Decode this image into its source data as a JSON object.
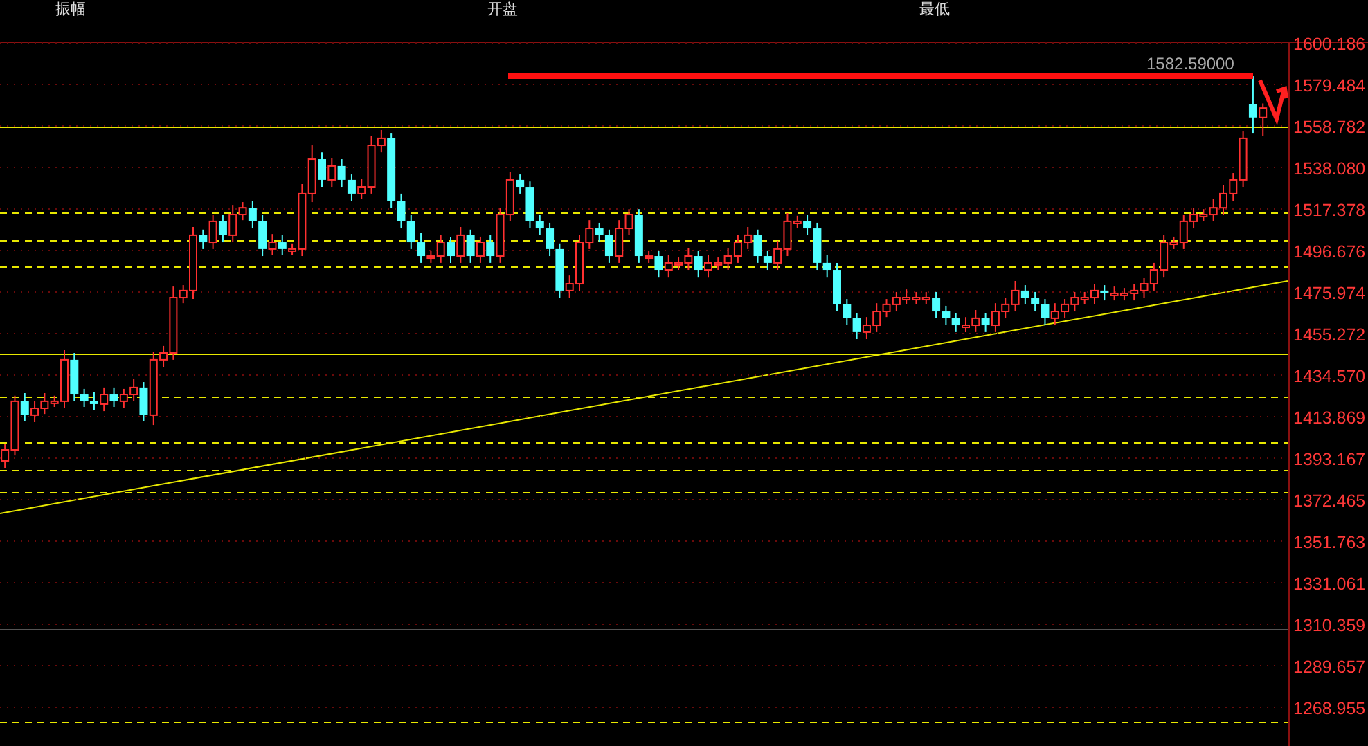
{
  "header": {
    "items": [
      {
        "label": "振幅"
      },
      {
        "label": "开盘"
      },
      {
        "label": "最低"
      }
    ]
  },
  "chart": {
    "price_marker": "1582.59000",
    "chart_data": {
      "type": "candlestick",
      "ylim": [
        1249.64,
        1600.87
      ],
      "grid": true,
      "categories": [
        null,
        null,
        null,
        null,
        null,
        null,
        null,
        null,
        null,
        null,
        null,
        null,
        null,
        null,
        null,
        null,
        null,
        null,
        null,
        null,
        null,
        null,
        null,
        null,
        null,
        null,
        null,
        null,
        null,
        null,
        null,
        null,
        null,
        null,
        null,
        null,
        null,
        null,
        null,
        null,
        null,
        null,
        null,
        null,
        null,
        null,
        null,
        null,
        null,
        null,
        null,
        null,
        null,
        null,
        null,
        null,
        null,
        null,
        null,
        null,
        null,
        null,
        null,
        null,
        null,
        null,
        null,
        null,
        null,
        null,
        null,
        null,
        null,
        null,
        null,
        null,
        null,
        null,
        null,
        null,
        null,
        null,
        null,
        null,
        null,
        null,
        null,
        null,
        null,
        null,
        null,
        null,
        null,
        null,
        null,
        null,
        null,
        null,
        null,
        null,
        null,
        null,
        null,
        null,
        null,
        null,
        null,
        null,
        null,
        null,
        null,
        null,
        null,
        null,
        null,
        null,
        null,
        null,
        null,
        null,
        null,
        null,
        null,
        null,
        null,
        null,
        null,
        null,
        null,
        null
      ],
      "yticks": [
        {
          "value": 1600.186,
          "label": "1600.186"
        },
        {
          "value": 1579.484,
          "label": "1579.484"
        },
        {
          "value": 1558.782,
          "label": "1558.782"
        },
        {
          "value": 1538.08,
          "label": "1538.080"
        },
        {
          "value": 1517.378,
          "label": "1517.378"
        },
        {
          "value": 1496.676,
          "label": "1496.676"
        },
        {
          "value": 1475.974,
          "label": "1475.974"
        },
        {
          "value": 1455.272,
          "label": "1455.272"
        },
        {
          "value": 1434.57,
          "label": "1434.570"
        },
        {
          "value": 1413.869,
          "label": "1413.869"
        },
        {
          "value": 1393.167,
          "label": "1393.167"
        },
        {
          "value": 1372.465,
          "label": "1372.465"
        },
        {
          "value": 1351.763,
          "label": "1351.763"
        },
        {
          "value": 1331.061,
          "label": "1331.061"
        },
        {
          "value": 1310.359,
          "label": "1310.359"
        },
        {
          "value": 1289.657,
          "label": "1289.657"
        },
        {
          "value": 1268.955,
          "label": "1268.955"
        }
      ],
      "ohlc": [
        [
          1391.8,
          1400.1,
          1388.0,
          1397.3
        ],
        [
          1397.3,
          1424.3,
          1394.5,
          1421.5
        ],
        [
          1421.5,
          1425.6,
          1411.8,
          1414.6
        ],
        [
          1414.6,
          1421.5,
          1411.1,
          1418.0
        ],
        [
          1418.0,
          1425.6,
          1415.2,
          1421.5
        ],
        [
          1421.5,
          1424.3,
          1418.7,
          1421.5
        ],
        [
          1421.5,
          1447.0,
          1418.0,
          1442.2
        ],
        [
          1442.2,
          1445.6,
          1421.5,
          1424.9
        ],
        [
          1424.9,
          1427.7,
          1418.7,
          1421.5
        ],
        [
          1421.5,
          1426.3,
          1417.3,
          1420.1
        ],
        [
          1420.1,
          1428.4,
          1416.6,
          1424.9
        ],
        [
          1424.9,
          1428.4,
          1418.7,
          1421.5
        ],
        [
          1421.5,
          1427.7,
          1418.0,
          1424.9
        ],
        [
          1424.9,
          1432.5,
          1421.5,
          1428.4
        ],
        [
          1428.4,
          1431.1,
          1411.8,
          1414.6
        ],
        [
          1414.6,
          1446.3,
          1409.7,
          1442.2
        ],
        [
          1442.2,
          1449.1,
          1438.7,
          1445.6
        ],
        [
          1445.6,
          1478.7,
          1442.2,
          1473.2
        ],
        [
          1473.2,
          1479.4,
          1470.4,
          1476.7
        ],
        [
          1476.7,
          1508.4,
          1472.5,
          1504.3
        ],
        [
          1504.3,
          1507.1,
          1497.4,
          1500.8
        ],
        [
          1500.8,
          1514.6,
          1497.4,
          1511.2
        ],
        [
          1511.2,
          1514.6,
          1500.8,
          1504.3
        ],
        [
          1504.3,
          1519.4,
          1500.8,
          1514.6
        ],
        [
          1514.6,
          1520.8,
          1511.8,
          1518.0
        ],
        [
          1518.0,
          1521.5,
          1507.7,
          1511.2
        ],
        [
          1511.2,
          1514.6,
          1493.9,
          1497.4
        ],
        [
          1497.4,
          1504.9,
          1494.6,
          1500.8
        ],
        [
          1500.8,
          1504.3,
          1494.6,
          1497.4
        ],
        [
          1497.4,
          1500.2,
          1494.6,
          1497.4
        ],
        [
          1497.4,
          1529.8,
          1493.9,
          1525.0
        ],
        [
          1525.0,
          1549.1,
          1520.8,
          1542.2
        ],
        [
          1542.2,
          1545.6,
          1528.4,
          1531.9
        ],
        [
          1531.9,
          1542.9,
          1528.4,
          1538.8
        ],
        [
          1538.8,
          1542.2,
          1528.4,
          1531.9
        ],
        [
          1531.9,
          1534.6,
          1521.5,
          1525.0
        ],
        [
          1525.0,
          1532.5,
          1522.2,
          1528.4
        ],
        [
          1528.4,
          1553.9,
          1525.0,
          1549.1
        ],
        [
          1549.1,
          1556.7,
          1545.6,
          1552.6
        ],
        [
          1552.6,
          1555.3,
          1518.0,
          1521.5
        ],
        [
          1521.5,
          1525.0,
          1507.7,
          1511.2
        ],
        [
          1511.2,
          1514.6,
          1497.4,
          1500.8
        ],
        [
          1500.8,
          1505.6,
          1490.5,
          1493.9
        ],
        [
          1493.9,
          1496.7,
          1490.5,
          1493.9
        ],
        [
          1493.9,
          1504.3,
          1490.5,
          1500.8
        ],
        [
          1500.8,
          1503.6,
          1490.5,
          1493.9
        ],
        [
          1493.9,
          1508.4,
          1490.5,
          1504.3
        ],
        [
          1504.3,
          1507.1,
          1490.5,
          1493.9
        ],
        [
          1493.9,
          1503.6,
          1490.5,
          1500.8
        ],
        [
          1500.8,
          1504.3,
          1490.5,
          1493.9
        ],
        [
          1493.9,
          1518.0,
          1490.5,
          1514.6
        ],
        [
          1514.6,
          1536.0,
          1511.2,
          1531.9
        ],
        [
          1531.9,
          1534.6,
          1525.0,
          1528.4
        ],
        [
          1528.4,
          1531.1,
          1507.7,
          1511.2
        ],
        [
          1511.2,
          1514.6,
          1504.3,
          1507.7
        ],
        [
          1507.7,
          1510.5,
          1493.9,
          1497.4
        ],
        [
          1497.4,
          1500.2,
          1473.2,
          1476.7
        ],
        [
          1476.7,
          1484.2,
          1473.2,
          1480.1
        ],
        [
          1480.1,
          1504.3,
          1476.7,
          1500.8
        ],
        [
          1500.8,
          1511.8,
          1497.4,
          1507.7
        ],
        [
          1507.7,
          1510.5,
          1500.8,
          1504.3
        ],
        [
          1504.3,
          1507.1,
          1490.5,
          1493.9
        ],
        [
          1493.9,
          1511.8,
          1490.5,
          1507.7
        ],
        [
          1507.7,
          1517.3,
          1504.3,
          1514.6
        ],
        [
          1514.6,
          1517.3,
          1490.5,
          1493.9
        ],
        [
          1493.9,
          1496.7,
          1490.5,
          1493.9
        ],
        [
          1493.9,
          1496.7,
          1483.5,
          1487.0
        ],
        [
          1487.0,
          1494.6,
          1483.5,
          1490.5
        ],
        [
          1490.5,
          1493.2,
          1487.0,
          1490.5
        ],
        [
          1490.5,
          1498.0,
          1487.0,
          1493.9
        ],
        [
          1493.9,
          1496.7,
          1483.5,
          1487.0
        ],
        [
          1487.0,
          1494.6,
          1483.5,
          1490.5
        ],
        [
          1490.5,
          1493.2,
          1487.0,
          1490.5
        ],
        [
          1490.5,
          1498.0,
          1487.0,
          1493.9
        ],
        [
          1493.9,
          1504.3,
          1490.5,
          1500.8
        ],
        [
          1500.8,
          1508.4,
          1497.4,
          1504.3
        ],
        [
          1504.3,
          1507.1,
          1490.5,
          1493.9
        ],
        [
          1493.9,
          1496.7,
          1487.0,
          1490.5
        ],
        [
          1490.5,
          1501.5,
          1487.0,
          1497.4
        ],
        [
          1497.4,
          1515.3,
          1493.9,
          1511.2
        ],
        [
          1511.2,
          1514.0,
          1507.7,
          1511.2
        ],
        [
          1511.2,
          1514.6,
          1504.3,
          1507.7
        ],
        [
          1507.7,
          1510.5,
          1487.0,
          1490.5
        ],
        [
          1490.5,
          1494.6,
          1483.5,
          1487.0
        ],
        [
          1487.0,
          1490.5,
          1466.3,
          1469.8
        ],
        [
          1469.8,
          1472.5,
          1459.4,
          1462.9
        ],
        [
          1462.9,
          1465.6,
          1452.5,
          1456.0
        ],
        [
          1456.0,
          1463.5,
          1452.5,
          1459.4
        ],
        [
          1459.4,
          1470.4,
          1456.0,
          1466.3
        ],
        [
          1466.3,
          1472.5,
          1463.5,
          1469.8
        ],
        [
          1469.8,
          1476.0,
          1466.3,
          1473.2
        ],
        [
          1473.2,
          1477.3,
          1469.8,
          1473.2
        ],
        [
          1473.2,
          1476.0,
          1469.8,
          1473.2
        ],
        [
          1473.2,
          1476.0,
          1469.8,
          1473.2
        ],
        [
          1473.2,
          1476.0,
          1462.9,
          1466.3
        ],
        [
          1466.3,
          1469.1,
          1459.4,
          1462.9
        ],
        [
          1462.9,
          1465.6,
          1456.0,
          1459.4
        ],
        [
          1459.4,
          1463.5,
          1456.0,
          1459.4
        ],
        [
          1459.4,
          1467.0,
          1456.0,
          1462.9
        ],
        [
          1462.9,
          1465.6,
          1456.0,
          1459.4
        ],
        [
          1459.4,
          1470.4,
          1456.0,
          1466.3
        ],
        [
          1466.3,
          1473.2,
          1462.9,
          1469.8
        ],
        [
          1469.8,
          1481.5,
          1466.3,
          1476.7
        ],
        [
          1476.7,
          1479.4,
          1469.8,
          1473.2
        ],
        [
          1473.2,
          1476.0,
          1466.3,
          1469.8
        ],
        [
          1469.8,
          1472.5,
          1459.4,
          1462.9
        ],
        [
          1462.9,
          1470.4,
          1459.4,
          1466.3
        ],
        [
          1466.3,
          1472.5,
          1462.9,
          1469.8
        ],
        [
          1469.8,
          1476.0,
          1466.3,
          1473.2
        ],
        [
          1473.2,
          1476.0,
          1469.8,
          1473.2
        ],
        [
          1473.2,
          1480.1,
          1469.8,
          1476.7
        ],
        [
          1476.7,
          1479.4,
          1471.8,
          1475.3
        ],
        [
          1475.3,
          1478.7,
          1471.8,
          1475.3
        ],
        [
          1475.3,
          1478.0,
          1471.8,
          1475.3
        ],
        [
          1475.3,
          1480.1,
          1471.8,
          1476.7
        ],
        [
          1476.7,
          1482.9,
          1473.2,
          1480.1
        ],
        [
          1480.1,
          1490.5,
          1476.7,
          1487.0
        ],
        [
          1487.0,
          1504.3,
          1483.5,
          1500.8
        ],
        [
          1500.8,
          1503.6,
          1497.4,
          1500.8
        ],
        [
          1500.8,
          1514.6,
          1497.4,
          1511.2
        ],
        [
          1511.2,
          1518.0,
          1507.7,
          1514.6
        ],
        [
          1514.6,
          1517.3,
          1511.2,
          1514.6
        ],
        [
          1514.6,
          1522.2,
          1511.2,
          1518.0
        ],
        [
          1518.0,
          1529.1,
          1514.6,
          1525.0
        ],
        [
          1525.0,
          1535.3,
          1521.5,
          1531.9
        ],
        [
          1531.9,
          1556.0,
          1528.4,
          1552.6
        ],
        [
          1569.8,
          1583.6,
          1555.3,
          1563.0
        ],
        [
          1563.0,
          1570.0,
          1553.9,
          1567.7
        ],
        null,
        null
      ]
    }
  }
}
